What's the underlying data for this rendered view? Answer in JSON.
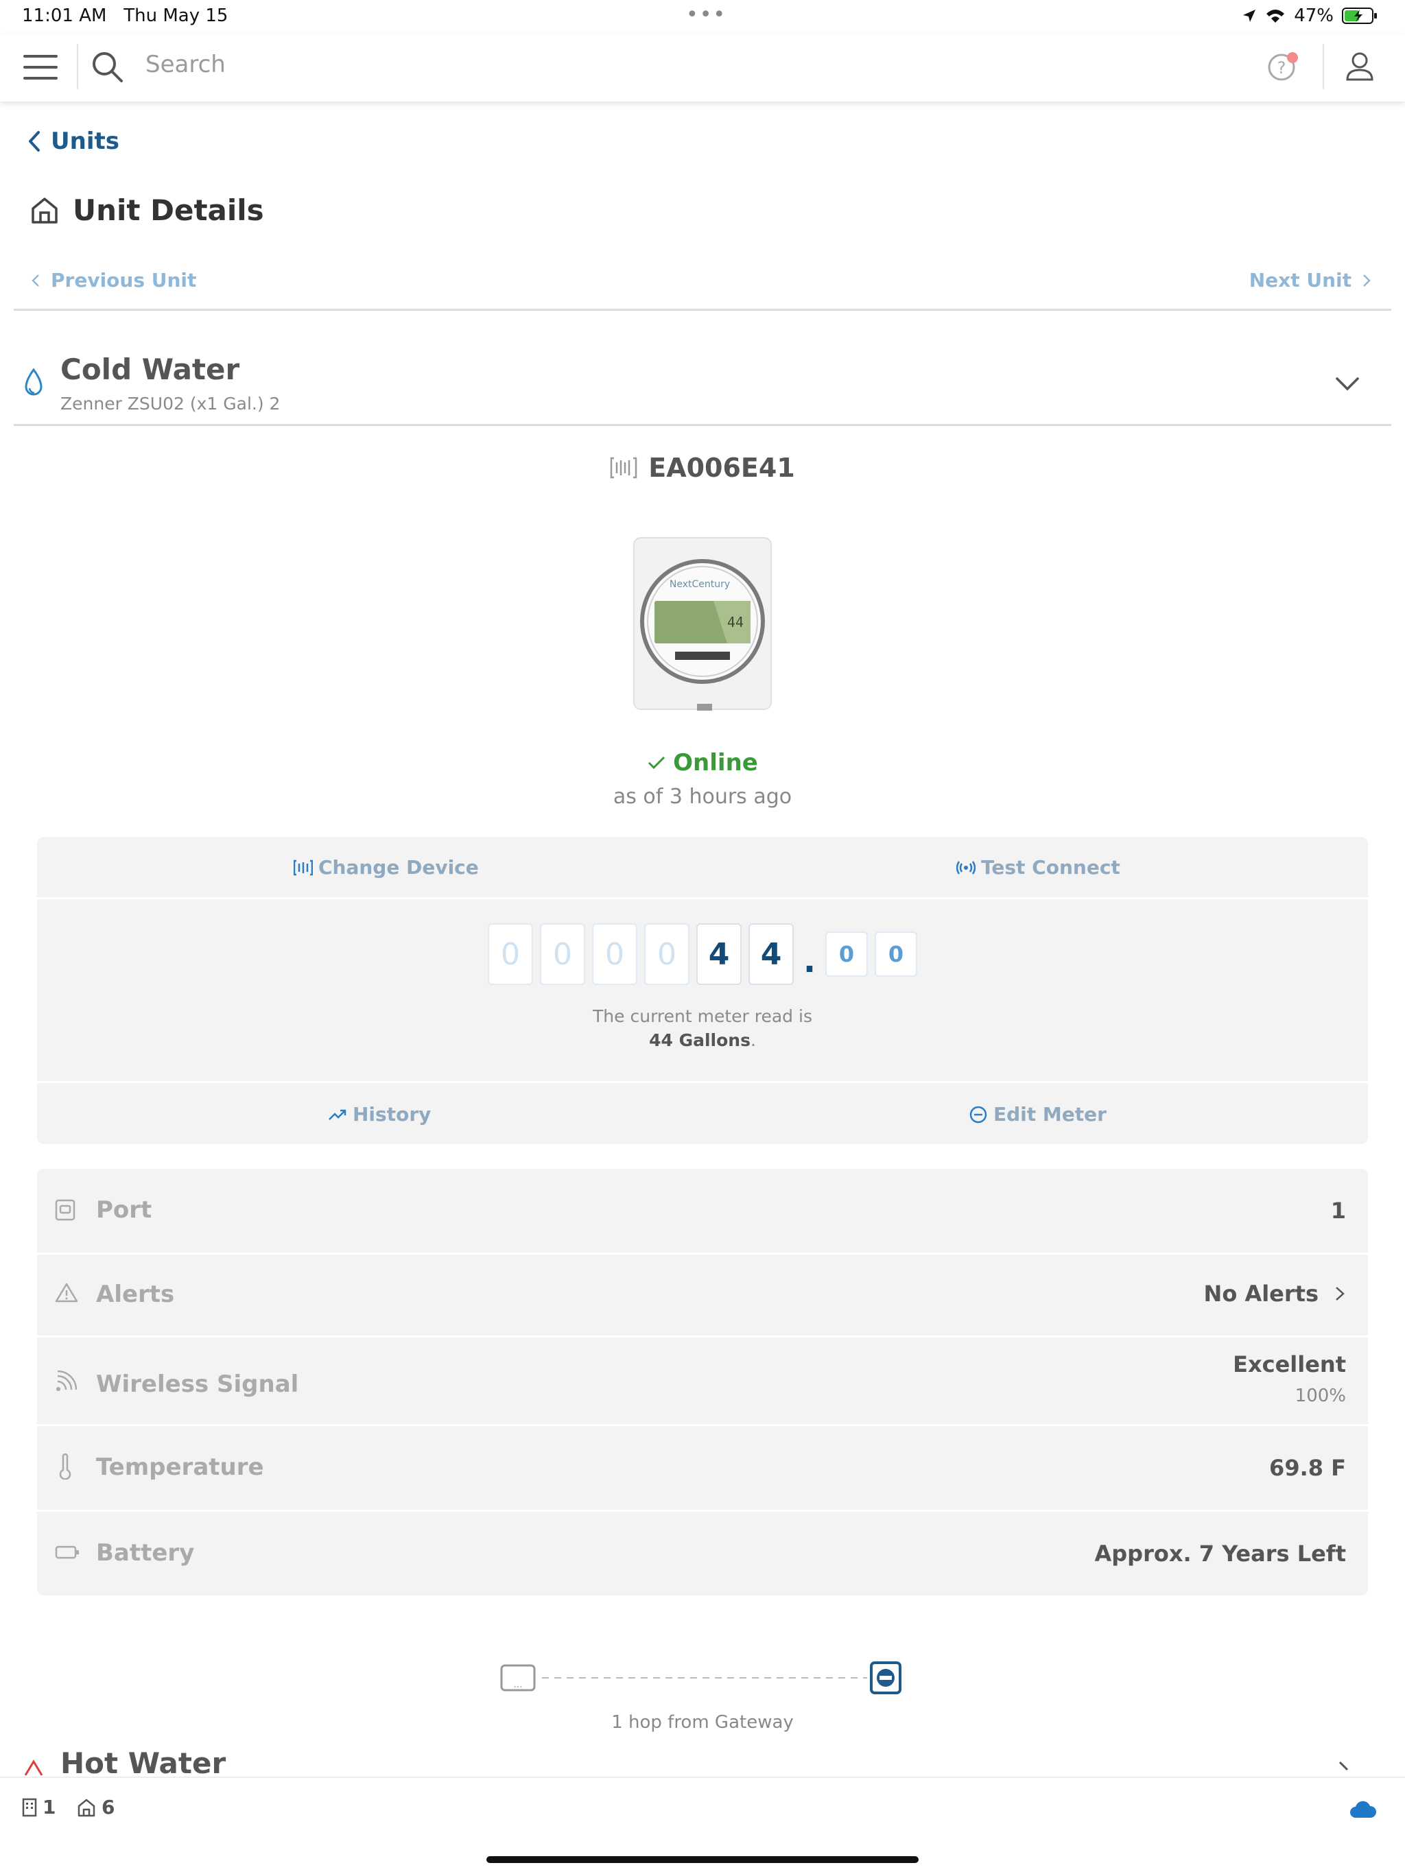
{
  "status_bar": {
    "time": "11:01 AM",
    "date": "Thu May 15",
    "battery": "47%"
  },
  "search": {
    "placeholder": "Search"
  },
  "nav": {
    "back_label": "Units",
    "page_title": "Unit Details",
    "prev_label": "Previous Unit",
    "next_label": "Next Unit"
  },
  "meter": {
    "title": "Cold Water",
    "subtitle": "Zenner ZSU02 (x1 Gal.) 2",
    "device_id": "EA006E41",
    "display_value": "44",
    "status": "Online",
    "status_time": "as of 3 hours ago",
    "change_device_label": "Change Device",
    "test_connect_label": "Test Connect",
    "digits": [
      "0",
      "0",
      "0",
      "0",
      "4",
      "4"
    ],
    "decimals": [
      "0",
      "0"
    ],
    "read_prefix": "The current meter read is",
    "read_value": "44 Gallons",
    "read_suffix": ".",
    "history_label": "History",
    "edit_meter_label": "Edit Meter"
  },
  "info": {
    "port_label": "Port",
    "port_value": "1",
    "alerts_label": "Alerts",
    "alerts_value": "No Alerts",
    "signal_label": "Wireless Signal",
    "signal_value": "Excellent",
    "signal_pct": "100%",
    "temp_label": "Temperature",
    "temp_value": "69.8 F",
    "battery_label": "Battery",
    "battery_value": "Approx. 7 Years Left"
  },
  "hop": {
    "text": "1 hop from Gateway"
  },
  "next_section": {
    "title": "Hot Water"
  },
  "bottom_bar": {
    "buildings_count": "1",
    "units_count": "6"
  },
  "colors": {
    "accent": "#1e5a8c",
    "online": "#3a9a3a",
    "link_light": "#8fb7d8",
    "card_bg": "#f3f3f3",
    "cloud": "#1f78c8",
    "hot": "#d9423a"
  }
}
